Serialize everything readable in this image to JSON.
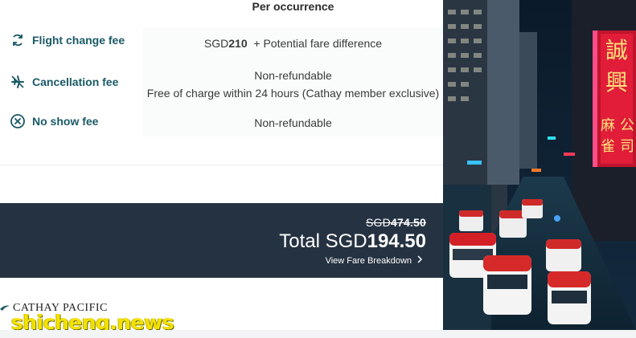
{
  "table": {
    "column_header": "Per occurrence",
    "rows": [
      {
        "label": "Flight change fee",
        "icon": "flight-change-icon",
        "currency": "SGD",
        "amount": "210",
        "extra": "+ Potential fare difference"
      },
      {
        "label": "Cancellation fee",
        "icon": "cancellation-icon",
        "line1": "Non-refundable",
        "line2": "Free of charge within 24 hours (Cathay member exclusive)"
      },
      {
        "label": "No show fee",
        "icon": "no-show-icon",
        "line1": "Non-refundable"
      }
    ]
  },
  "summary": {
    "original_currency": "SGD",
    "original_amount": "474.50",
    "total_prefix": "Total SGD",
    "total_amount": "194.50",
    "breakdown_link": "View Fare Breakdown"
  },
  "brand": {
    "logo_text": "CATHAY PACIFIC",
    "accent": "#1a5a66",
    "summary_bg": "#253241"
  },
  "watermark": "shicheng.news",
  "photo": {
    "signs": [
      "誠",
      "興",
      "麻",
      "雀",
      "公",
      "司"
    ]
  }
}
